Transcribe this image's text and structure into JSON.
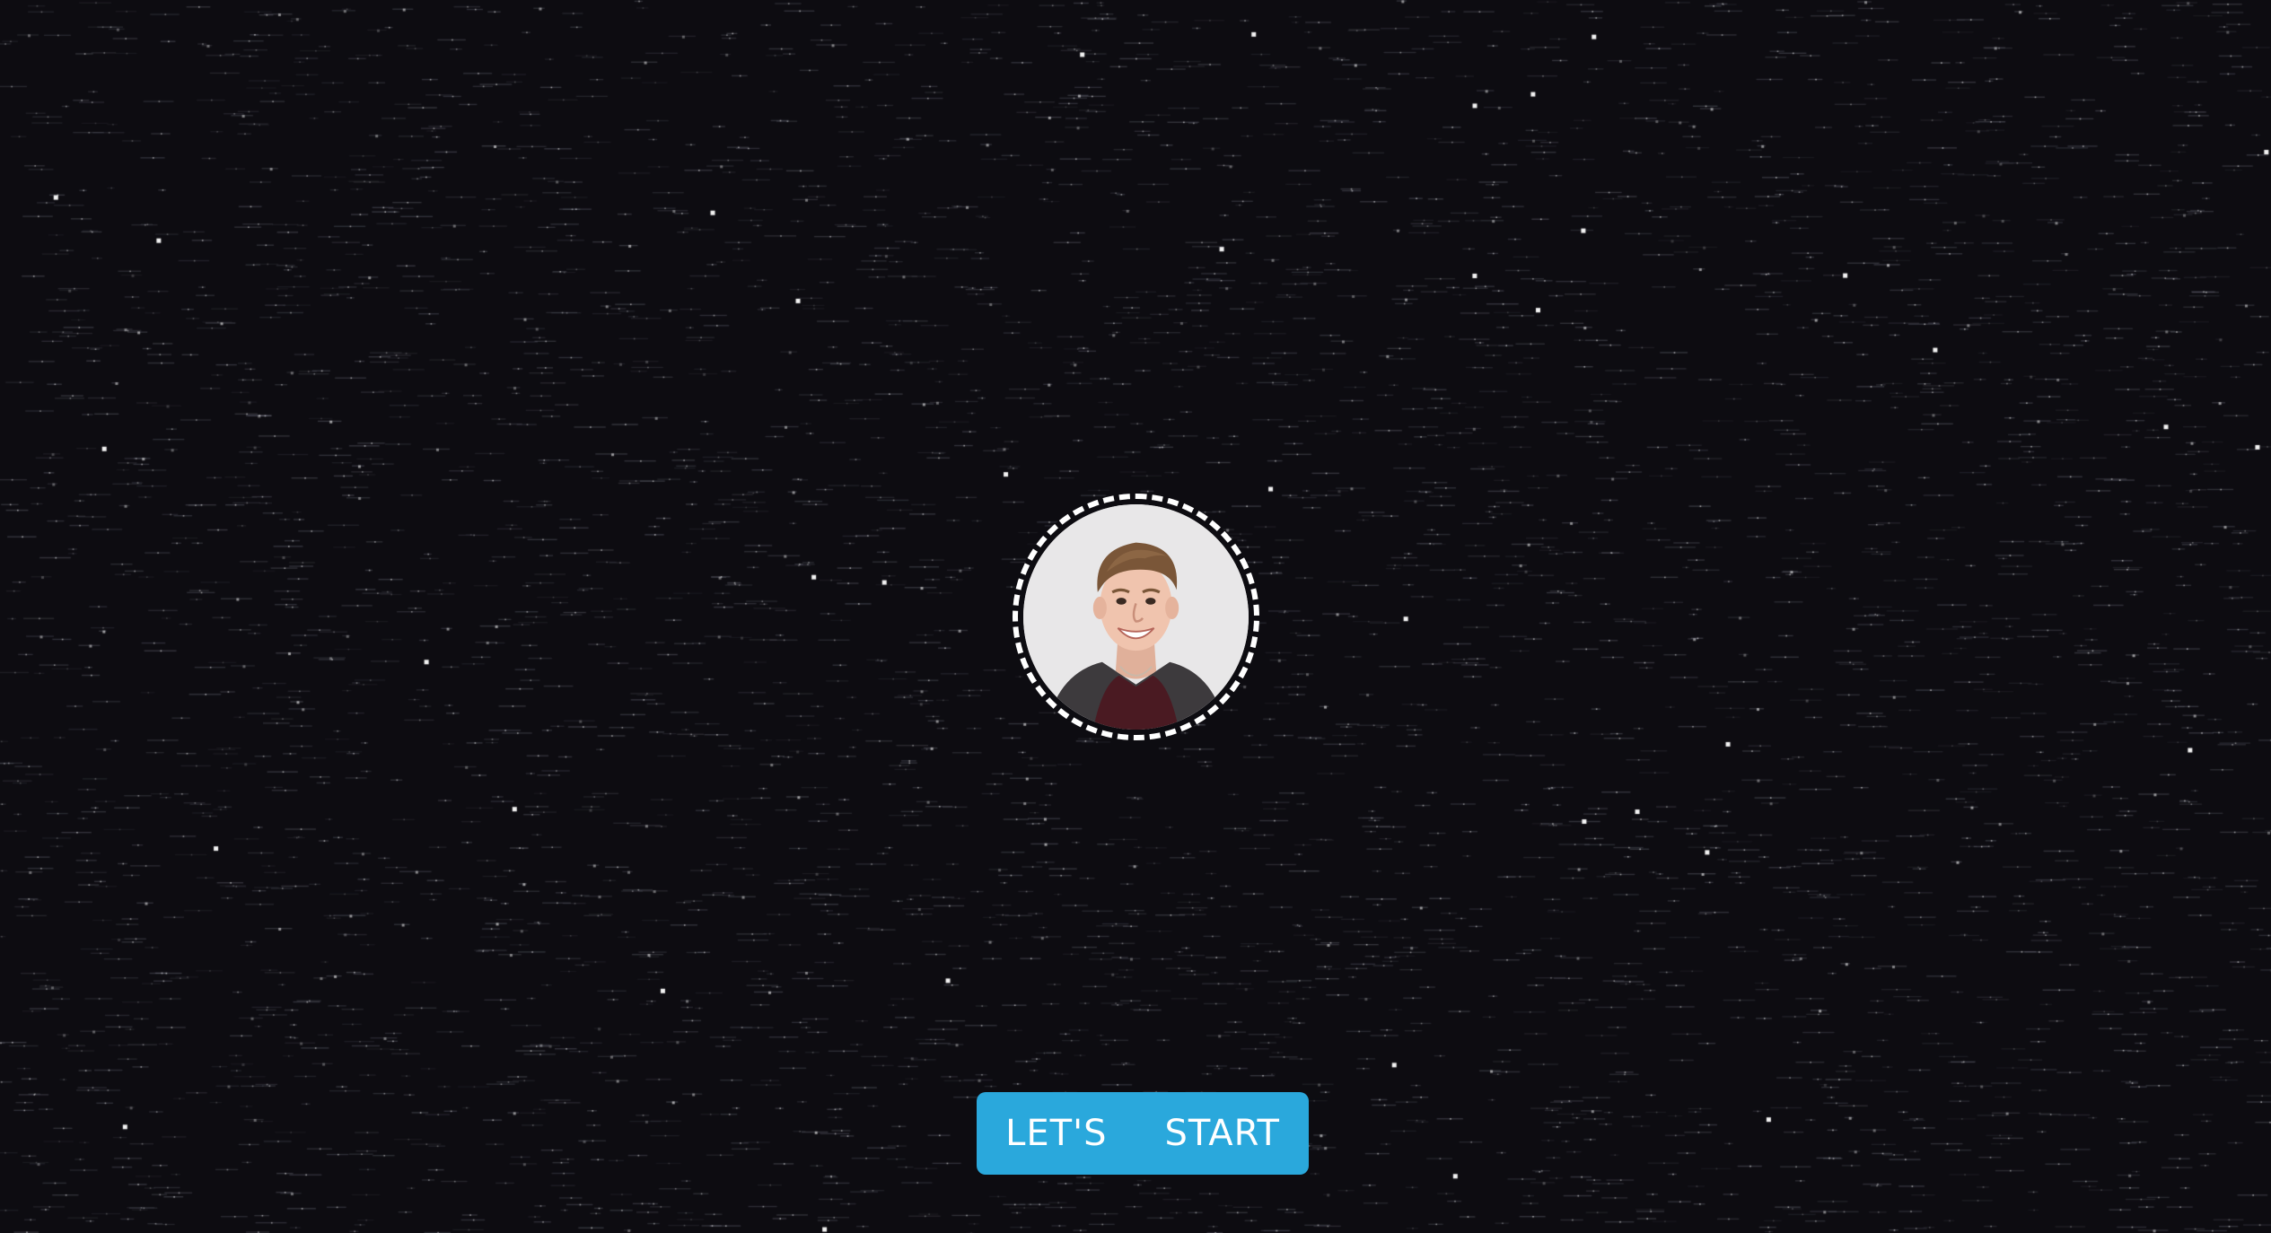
{
  "background": {
    "color": "#0d0c11",
    "style": "starfield",
    "star_color": "#ffffff"
  },
  "avatar": {
    "icon": "profile-photo",
    "border_style": "dashed",
    "border_color": "#ffffff"
  },
  "cta": {
    "word1": "LET'S",
    "word2": "START",
    "background_color": "#2aa8dc",
    "text_color": "#ffffff"
  }
}
